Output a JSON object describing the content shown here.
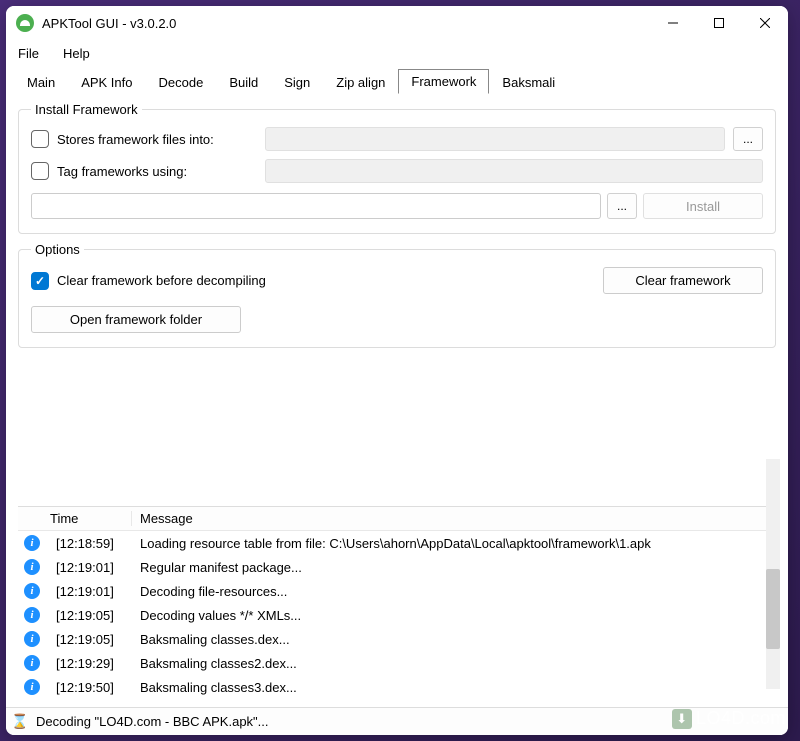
{
  "window": {
    "title": "APKTool GUI - v3.0.2.0"
  },
  "menubar": {
    "file": "File",
    "help": "Help"
  },
  "tabs": [
    {
      "label": "Main"
    },
    {
      "label": "APK Info"
    },
    {
      "label": "Decode"
    },
    {
      "label": "Build"
    },
    {
      "label": "Sign"
    },
    {
      "label": "Zip align"
    },
    {
      "label": "Framework",
      "active": true
    },
    {
      "label": "Baksmali"
    }
  ],
  "install_framework": {
    "legend": "Install Framework",
    "stores_label": "Stores framework files into:",
    "tag_label": "Tag frameworks using:",
    "browse_label": "...",
    "path_value": "",
    "install_label": "Install"
  },
  "options": {
    "legend": "Options",
    "clear_before_label": "Clear framework before decompiling",
    "clear_btn": "Clear framework",
    "open_folder_btn": "Open framework folder"
  },
  "log": {
    "header_time": "Time",
    "header_message": "Message",
    "rows": [
      {
        "time": "[12:18:59]",
        "msg": "Loading resource table from file: C:\\Users\\ahorn\\AppData\\Local\\apktool\\framework\\1.apk"
      },
      {
        "time": "[12:19:01]",
        "msg": "Regular manifest package..."
      },
      {
        "time": "[12:19:01]",
        "msg": "Decoding file-resources..."
      },
      {
        "time": "[12:19:05]",
        "msg": "Decoding values */* XMLs..."
      },
      {
        "time": "[12:19:05]",
        "msg": "Baksmaling classes.dex..."
      },
      {
        "time": "[12:19:29]",
        "msg": "Baksmaling classes2.dex..."
      },
      {
        "time": "[12:19:50]",
        "msg": "Baksmaling classes3.dex..."
      }
    ]
  },
  "statusbar": {
    "text": "Decoding \"LO4D.com - BBC APK.apk\"..."
  },
  "watermark": {
    "text": "LO4D.com"
  }
}
